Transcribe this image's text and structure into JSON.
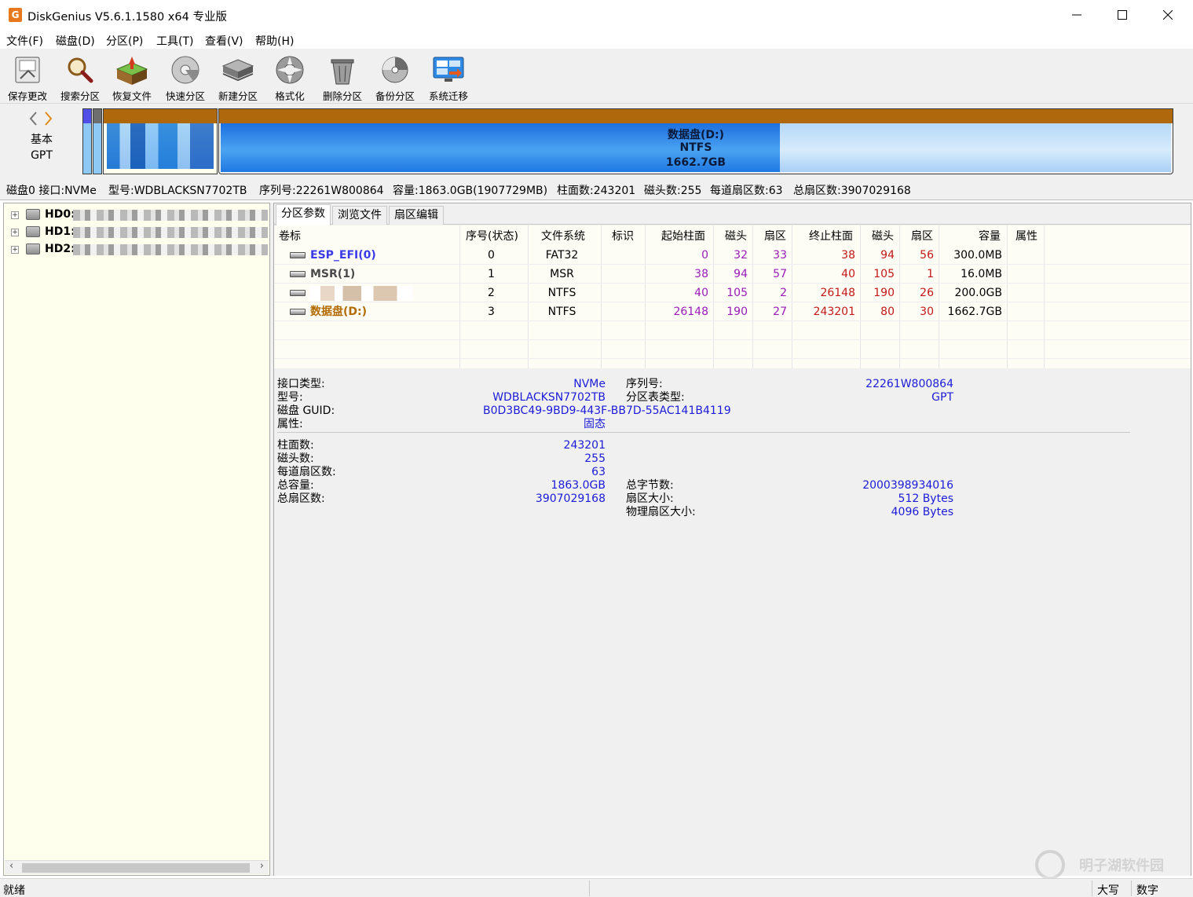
{
  "window": {
    "title": "DiskGenius V5.6.1.1580 x64 专业版",
    "app_icon_letter": "G"
  },
  "menu": [
    "文件(F)",
    "磁盘(D)",
    "分区(P)",
    "工具(T)",
    "查看(V)",
    "帮助(H)"
  ],
  "toolbar": [
    {
      "label": "保存更改",
      "icon": "save-icon"
    },
    {
      "label": "搜索分区",
      "icon": "search-icon"
    },
    {
      "label": "恢复文件",
      "icon": "recover-files-icon"
    },
    {
      "label": "快速分区",
      "icon": "quick-partition-icon"
    },
    {
      "label": "新建分区",
      "icon": "new-partition-icon"
    },
    {
      "label": "格式化",
      "icon": "format-icon"
    },
    {
      "label": "删除分区",
      "icon": "delete-partition-icon"
    },
    {
      "label": "备份分区",
      "icon": "backup-partition-icon"
    },
    {
      "label": "系统迁移",
      "icon": "system-migrate-icon"
    }
  ],
  "diskmap": {
    "line1": "基本",
    "line2": "GPT",
    "data_partition": {
      "name": "数据盘(D:)",
      "fs": "NTFS",
      "size": "1662.7GB"
    },
    "colors": {
      "bar_top": "#b0680c",
      "data_fill": "#2f8ae6",
      "data_light": "#7ab8f5",
      "free_fill": "#b8daf8"
    }
  },
  "infobar": {
    "disk": "磁盘0 接口:NVMe",
    "model": "型号:WDBLACKSN7702TB",
    "serial": "序列号:22261W800864",
    "capacity": "容量:1863.0GB(1907729MB)",
    "cylinders": "柱面数:243201",
    "heads": "磁头数:255",
    "sectors_per_track": "每道扇区数:63",
    "total_sectors": "总扇区数:3907029168"
  },
  "tree": [
    {
      "label": "HD0:"
    },
    {
      "label": "HD1:"
    },
    {
      "label": "HD2:"
    }
  ],
  "tabs": [
    "分区参数",
    "浏览文件",
    "扇区编辑"
  ],
  "partition_table": {
    "headers": [
      "卷标",
      "序号(状态)",
      "文件系统",
      "标识",
      "起始柱面",
      "磁头",
      "扇区",
      "终止柱面",
      "磁头",
      "扇区",
      "容量",
      "属性"
    ],
    "rows": [
      {
        "name": "ESP_EFI(0)",
        "index": "0",
        "fs": "FAT32",
        "flag": "",
        "start_cyl": "0",
        "start_head": "32",
        "start_sec": "33",
        "end_cyl": "38",
        "end_head": "94",
        "end_sec": "56",
        "size": "300.0MB",
        "attr": "",
        "color": "#3a3ae6"
      },
      {
        "name": "MSR(1)",
        "index": "1",
        "fs": "MSR",
        "flag": "",
        "start_cyl": "38",
        "start_head": "94",
        "start_sec": "57",
        "end_cyl": "40",
        "end_head": "105",
        "end_sec": "1",
        "size": "16.0MB",
        "attr": "",
        "color": "#4a4a4a"
      },
      {
        "name": "",
        "index": "2",
        "fs": "NTFS",
        "flag": "",
        "start_cyl": "40",
        "start_head": "105",
        "start_sec": "2",
        "end_cyl": "26148",
        "end_head": "190",
        "end_sec": "26",
        "size": "200.0GB",
        "attr": "",
        "color": "#9a5a10"
      },
      {
        "name": "数据盘(D:)",
        "index": "3",
        "fs": "NTFS",
        "flag": "",
        "start_cyl": "26148",
        "start_head": "190",
        "start_sec": "27",
        "end_cyl": "243201",
        "end_head": "80",
        "end_sec": "30",
        "size": "1662.7GB",
        "attr": "",
        "color": "#b26b00"
      }
    ],
    "colors": {
      "start": "#9a1ab8",
      "end": "#c21818"
    }
  },
  "details": {
    "interface_label": "接口类型:",
    "interface_value": "NVMe",
    "serial_label": "序列号:",
    "serial_value": "22261W800864",
    "model_label": "型号:",
    "model_value": "WDBLACKSN7702TB",
    "pt_label": "分区表类型:",
    "pt_value": "GPT",
    "guid_label": "磁盘 GUID:",
    "guid_value": "B0D3BC49-9BD9-443F-BB7D-55AC141B4119",
    "attr_label": "属性:",
    "attr_value": "固态",
    "cyl_label": "柱面数:",
    "cyl_value": "243201",
    "heads_label": "磁头数:",
    "heads_value": "255",
    "spt_label": "每道扇区数:",
    "spt_value": "63",
    "cap_label": "总容量:",
    "cap_value": "1863.0GB",
    "bytes_label": "总字节数:",
    "bytes_value": "2000398934016",
    "sectors_label": "总扇区数:",
    "sectors_value": "3907029168",
    "secsize_label": "扇区大小:",
    "secsize_value": "512 Bytes",
    "physsec_label": "物理扇区大小:",
    "physsec_value": "4096 Bytes"
  },
  "statusbar": {
    "status": "就绪",
    "caps": "大写",
    "num": "数字"
  },
  "watermark": "明子湖软件园"
}
